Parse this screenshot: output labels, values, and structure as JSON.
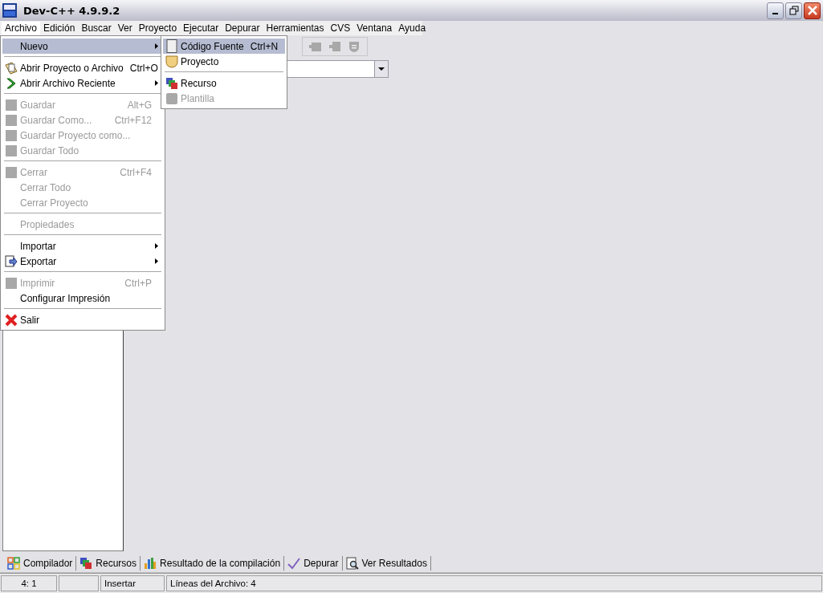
{
  "window": {
    "title": "Dev-C++ 4.9.9.2"
  },
  "menubar": [
    {
      "label": "Archivo",
      "selected": true
    },
    {
      "label": "Edición",
      "selected": false
    },
    {
      "label": "Buscar",
      "selected": false
    },
    {
      "label": "Ver",
      "selected": false
    },
    {
      "label": "Proyecto",
      "selected": false
    },
    {
      "label": "Ejecutar",
      "selected": false
    },
    {
      "label": "Depurar",
      "selected": false
    },
    {
      "label": "Herramientas",
      "selected": false
    },
    {
      "label": "CVS",
      "selected": false
    },
    {
      "label": "Ventana",
      "selected": false
    },
    {
      "label": "Ayuda",
      "selected": false
    }
  ],
  "file_menu": [
    {
      "kind": "item",
      "label": "Nuevo",
      "has_submenu": true,
      "disabled": false,
      "selected": true
    },
    {
      "kind": "separator"
    },
    {
      "kind": "item",
      "label": "Abrir Proyecto o Archivo",
      "shortcut": "Ctrl+O",
      "has_submenu": false,
      "disabled": false,
      "selected": false
    },
    {
      "kind": "item",
      "label": "Abrir Archivo Reciente",
      "has_submenu": true,
      "disabled": false,
      "selected": false
    },
    {
      "kind": "separator"
    },
    {
      "kind": "item",
      "label": "Guardar",
      "shortcut": "Alt+G",
      "has_submenu": false,
      "disabled": true,
      "selected": false
    },
    {
      "kind": "item",
      "label": "Guardar Como...",
      "shortcut": "Ctrl+F12",
      "has_submenu": false,
      "disabled": true,
      "selected": false
    },
    {
      "kind": "item",
      "label": "Guardar Proyecto como...",
      "has_submenu": false,
      "disabled": true,
      "selected": false
    },
    {
      "kind": "item",
      "label": "Guardar Todo",
      "has_submenu": false,
      "disabled": true,
      "selected": false
    },
    {
      "kind": "separator"
    },
    {
      "kind": "item",
      "label": "Cerrar",
      "shortcut": "Ctrl+F4",
      "has_submenu": false,
      "disabled": true,
      "selected": false
    },
    {
      "kind": "item",
      "label": "Cerrar Todo",
      "has_submenu": false,
      "disabled": true,
      "selected": false
    },
    {
      "kind": "item",
      "label": "Cerrar Proyecto",
      "has_submenu": false,
      "disabled": true,
      "selected": false
    },
    {
      "kind": "separator"
    },
    {
      "kind": "item",
      "label": "Propiedades",
      "has_submenu": false,
      "disabled": true,
      "selected": false
    },
    {
      "kind": "separator"
    },
    {
      "kind": "item",
      "label": "Importar",
      "has_submenu": true,
      "disabled": false,
      "selected": false
    },
    {
      "kind": "item",
      "label": "Exportar",
      "has_submenu": true,
      "disabled": false,
      "selected": false
    },
    {
      "kind": "separator"
    },
    {
      "kind": "item",
      "label": "Imprimir",
      "shortcut": "Ctrl+P",
      "has_submenu": false,
      "disabled": true,
      "selected": false
    },
    {
      "kind": "item",
      "label": "Configurar Impresión",
      "has_submenu": false,
      "disabled": false,
      "selected": false
    },
    {
      "kind": "separator"
    },
    {
      "kind": "item",
      "label": "Salir",
      "has_submenu": false,
      "disabled": false,
      "selected": false
    }
  ],
  "new_submenu": [
    {
      "kind": "item",
      "label": "Código Fuente",
      "shortcut": "Ctrl+N",
      "disabled": false,
      "selected": true
    },
    {
      "kind": "item",
      "label": "Proyecto",
      "disabled": false,
      "selected": false
    },
    {
      "kind": "separator"
    },
    {
      "kind": "item",
      "label": "Recurso",
      "disabled": false,
      "selected": false
    },
    {
      "kind": "item",
      "label": "Plantilla",
      "disabled": true,
      "selected": false
    }
  ],
  "bottom_tabs": [
    {
      "label": "Compilador"
    },
    {
      "label": "Recursos"
    },
    {
      "label": "Resultado de la compilación"
    },
    {
      "label": "Depurar"
    },
    {
      "label": "Ver Resultados"
    }
  ],
  "status_bar": {
    "position": "4: 1",
    "mode": "Insertar",
    "info": "Líneas del Archivo: 4"
  }
}
